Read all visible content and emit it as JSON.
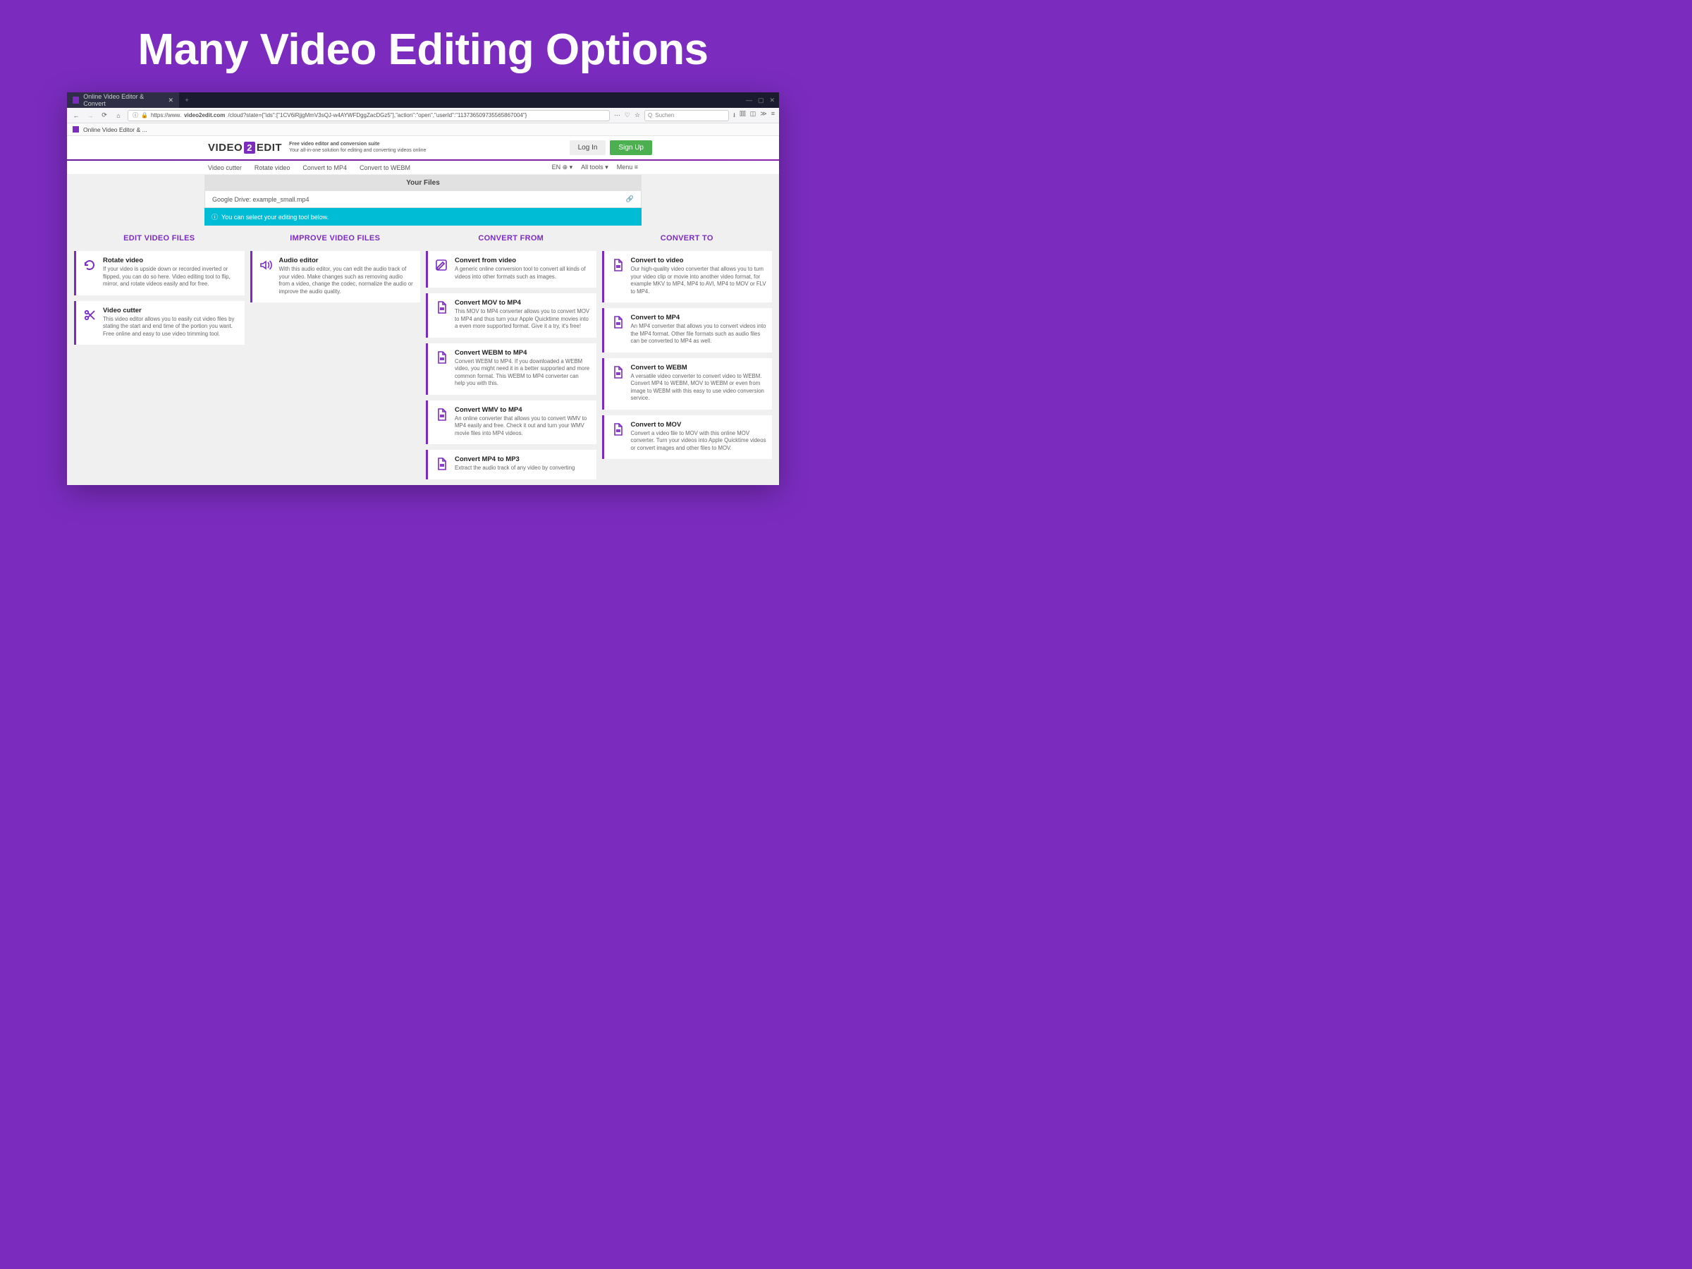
{
  "hero": {
    "title": "Many Video Editing Options"
  },
  "browser": {
    "tab_title": "Online Video Editor & Convert",
    "window_min": "—",
    "window_max": "▢",
    "window_close": "✕",
    "new_tab": "+",
    "url_prefix": "https://www.",
    "url_host": "video2edit.com",
    "url_path": "/cloud?state={\"ids\":[\"1CV6iRjjgMmV3sQJ-w4AYWFDggZacDGz5\"],\"action\":\"open\",\"userId\":\"113736509735565867004\"}",
    "search_placeholder": "Suchen",
    "bookmark": "Online Video Editor & ..."
  },
  "site": {
    "logo_left": "VIDEO",
    "logo_mid": "2",
    "logo_right": "EDIT",
    "tagline_1": "Free video editor and conversion suite",
    "tagline_2": "Your all-in-one solution for editing and converting videos online",
    "login": "Log In",
    "signup": "Sign Up"
  },
  "nav": {
    "items": [
      "Video cutter",
      "Rotate video",
      "Convert to MP4",
      "Convert to WEBM"
    ],
    "lang": "EN",
    "all_tools": "All tools",
    "menu": "Menu"
  },
  "files": {
    "header": "Your Files",
    "row": "Google Drive: example_small.mp4",
    "info": "You can select your editing tool below."
  },
  "columns": [
    {
      "header": "EDIT VIDEO FILES",
      "cards": [
        {
          "icon": "rotate",
          "title": "Rotate video",
          "desc": "If your video is upside down or recorded inverted or flipped, you can do so here. Video editing tool to flip, mirror, and rotate videos easily and for free."
        },
        {
          "icon": "cut",
          "title": "Video cutter",
          "desc": "This video editor allows you to easily cut video files by stating the start and end time of the portion you want. Free online and easy to use video trimming tool."
        }
      ]
    },
    {
      "header": "IMPROVE VIDEO FILES",
      "cards": [
        {
          "icon": "audio",
          "title": "Audio editor",
          "desc": "With this audio editor, you can edit the audio track of your video. Make changes such as removing audio from a video, change the codec, normalize the audio or improve the audio quality."
        }
      ]
    },
    {
      "header": "CONVERT FROM",
      "cards": [
        {
          "icon": "edit",
          "title": "Convert from video",
          "desc": "A generic online conversion tool to convert all kinds of videos into other formats such as images."
        },
        {
          "icon": "file",
          "title": "Convert MOV to MP4",
          "desc": "This MOV to MP4 converter allows you to convert MOV to MP4 and thus turn your Apple Quicktime movies into a even more supported format. Give it a try, it's free!"
        },
        {
          "icon": "file",
          "title": "Convert WEBM to MP4",
          "desc": "Convert WEBM to MP4. If you downloaded a WEBM video, you might need it in a better supported and more common format. This WEBM to MP4 converter can help you with this."
        },
        {
          "icon": "file",
          "title": "Convert WMV to MP4",
          "desc": "An online converter that allows you to convert WMV to MP4 easily and free. Check it out and turn your WMV movie files into MP4 videos."
        },
        {
          "icon": "file",
          "title": "Convert MP4 to MP3",
          "desc": "Extract the audio track of any video by converting"
        }
      ]
    },
    {
      "header": "CONVERT TO",
      "cards": [
        {
          "icon": "file",
          "title": "Convert to video",
          "desc": "Our high-quality video converter that allows you to turn your video clip or movie into another video format, for example MKV to MP4, MP4 to AVI, MP4 to MOV or FLV to MP4."
        },
        {
          "icon": "file",
          "title": "Convert to MP4",
          "desc": "An MP4 converter that allows you to convert videos into the MP4 format. Other file formats such as audio files can be converted to MP4 as well."
        },
        {
          "icon": "file",
          "title": "Convert to WEBM",
          "desc": "A versatile video converter to convert video to WEBM. Convert MP4 to WEBM, MOV to WEBM or even from image to WEBM with this easy to use video conversion service."
        },
        {
          "icon": "file",
          "title": "Convert to MOV",
          "desc": "Convert a video file to MOV with this online MOV converter. Turn your videos into Apple Quicktime videos or convert images and other files to MOV."
        }
      ]
    }
  ]
}
